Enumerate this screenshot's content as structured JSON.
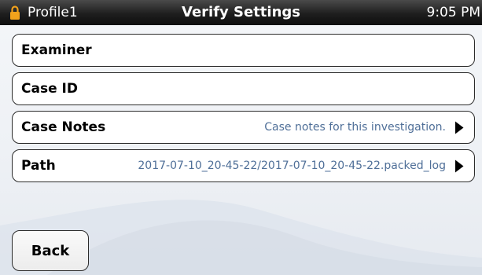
{
  "status_bar": {
    "profile_name": "Profile1",
    "title": "Verify Settings",
    "time": "9:05 PM",
    "lock_icon": "lock-icon",
    "lock_color": "#f2a21c"
  },
  "settings": [
    {
      "label": "Examiner",
      "value": ""
    },
    {
      "label": "Case ID",
      "value": ""
    },
    {
      "label": "Case Notes",
      "value": "Case notes for this investigation.",
      "icon": "chevron-right-icon"
    },
    {
      "label": "Path",
      "value": "2017-07-10_20-45-22/2017-07-10_20-45-22.packed_log",
      "icon": "chevron-right-icon"
    }
  ],
  "footer": {
    "back_label": "Back"
  },
  "colors": {
    "value_text": "#4f6f98",
    "row_border": "#2b2b2b"
  }
}
